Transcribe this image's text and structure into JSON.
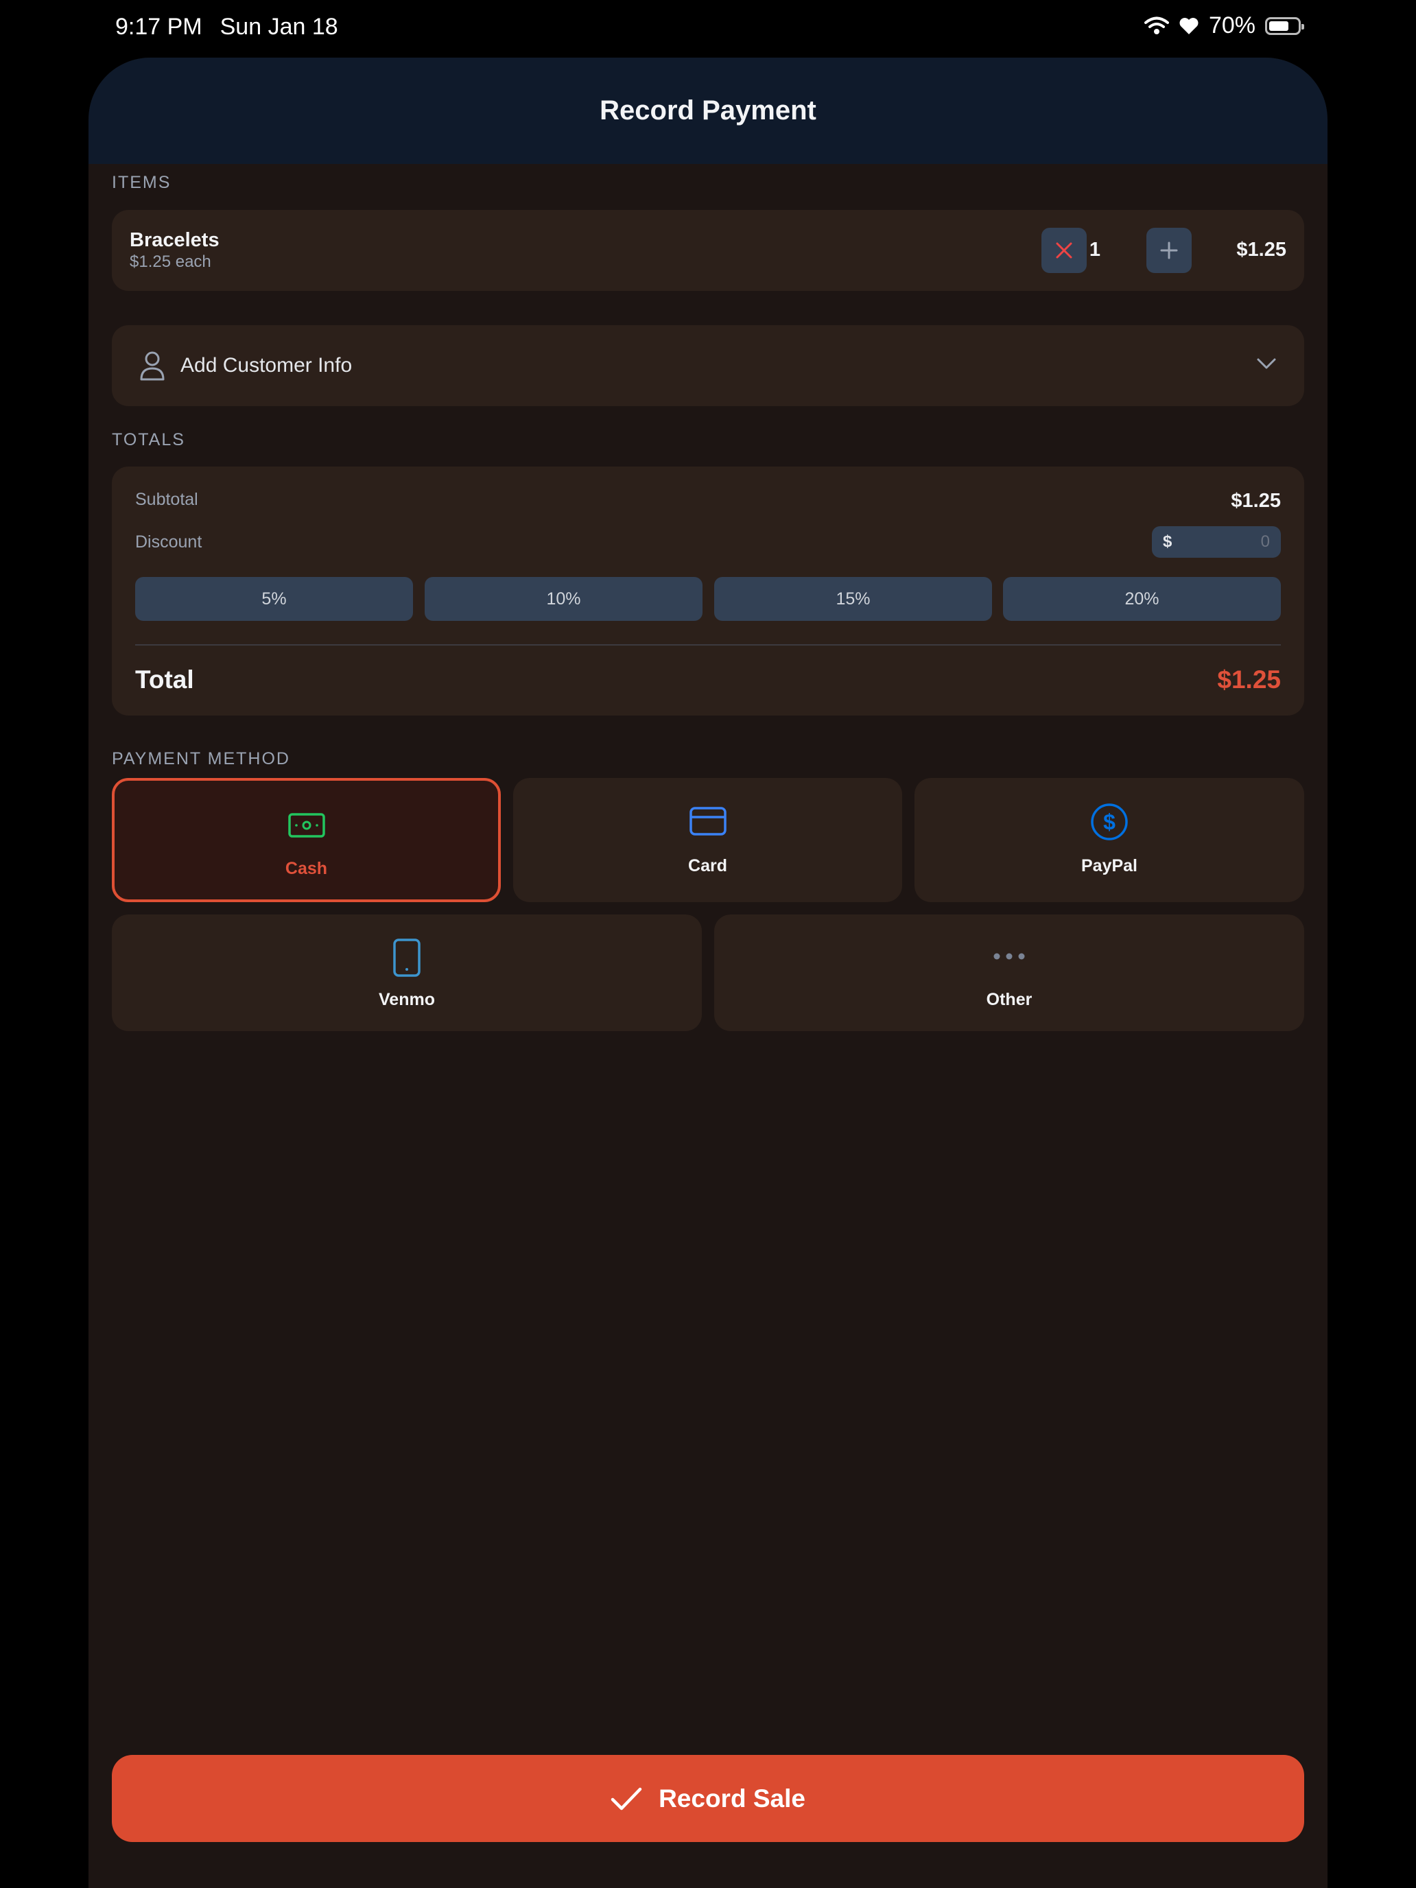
{
  "status_bar": {
    "time": "9:17 PM",
    "date": "Sun Jan 18",
    "battery": "70%",
    "battery_level": 0.7
  },
  "header": {
    "title": "Record Payment"
  },
  "items_section": {
    "label": "ITEMS",
    "items": [
      {
        "name": "Bracelets",
        "unit_price": "$1.25 each",
        "quantity": "1",
        "total": "$1.25"
      }
    ]
  },
  "customer": {
    "label": "Add Customer Info"
  },
  "totals": {
    "label": "TOTALS",
    "subtotal_label": "Subtotal",
    "subtotal_value": "$1.25",
    "discount_label": "Discount",
    "discount_prefix": "$",
    "discount_placeholder": "0",
    "presets": [
      "5%",
      "10%",
      "15%",
      "20%"
    ],
    "total_label": "Total",
    "total_value": "$1.25"
  },
  "payment": {
    "label": "PAYMENT METHOD",
    "selected": "Cash",
    "methods": [
      {
        "label": "Cash",
        "icon": "cash-icon",
        "color": "#22c55e"
      },
      {
        "label": "Card",
        "icon": "card-icon",
        "color": "#3b82f6"
      },
      {
        "label": "PayPal",
        "icon": "dollar-circle-icon",
        "color": "#0070e0"
      },
      {
        "label": "Venmo",
        "icon": "phone-icon",
        "color": "#3d95ce"
      },
      {
        "label": "Other",
        "icon": "more-icon",
        "color": "#9aa3b2"
      }
    ]
  },
  "actions": {
    "record_label": "Record Sale"
  },
  "colors": {
    "accent": "#db4b30",
    "header_bg": "#0f1a2b",
    "card_bg": "#2c201a",
    "page_bg": "#1d1513"
  }
}
